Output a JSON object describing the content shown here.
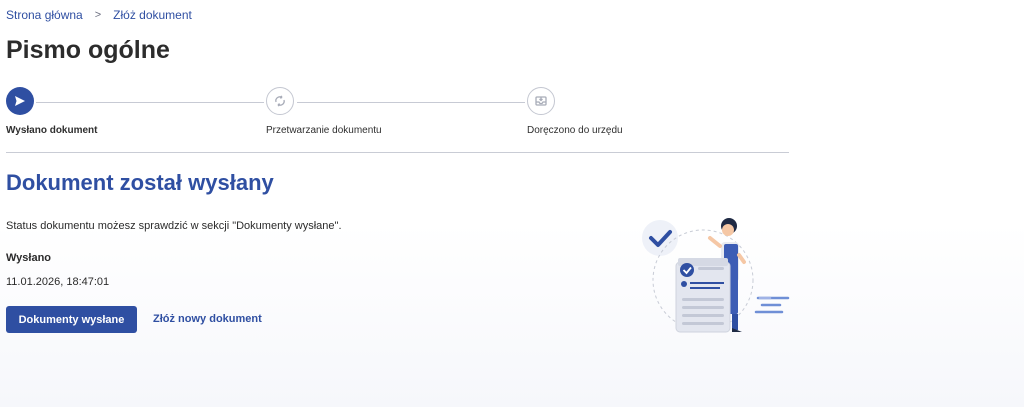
{
  "breadcrumb": {
    "home": "Strona główna",
    "separator": ">",
    "current": "Złóż dokument"
  },
  "page_title": "Pismo ogólne",
  "stepper": {
    "steps": [
      {
        "label": "Wysłano dokument",
        "state": "active",
        "icon": "send-icon"
      },
      {
        "label": "Przetwarzanie dokumentu",
        "state": "idle",
        "icon": "refresh-icon"
      },
      {
        "label": "Doręczono do urzędu",
        "state": "idle",
        "icon": "inbox-icon"
      }
    ]
  },
  "confirmation": {
    "heading": "Dokument został wysłany",
    "status_text": "Status dokumentu możesz sprawdzić w sekcji \"Dokumenty wysłane\".",
    "sent_label": "Wysłano",
    "sent_date": "11.01.2026, 18:47:01"
  },
  "actions": {
    "primary": "Dokumenty wysłane",
    "secondary": "Złóż nowy dokument"
  },
  "colors": {
    "accent": "#2f4fa2",
    "divider": "#c9ccd5"
  }
}
